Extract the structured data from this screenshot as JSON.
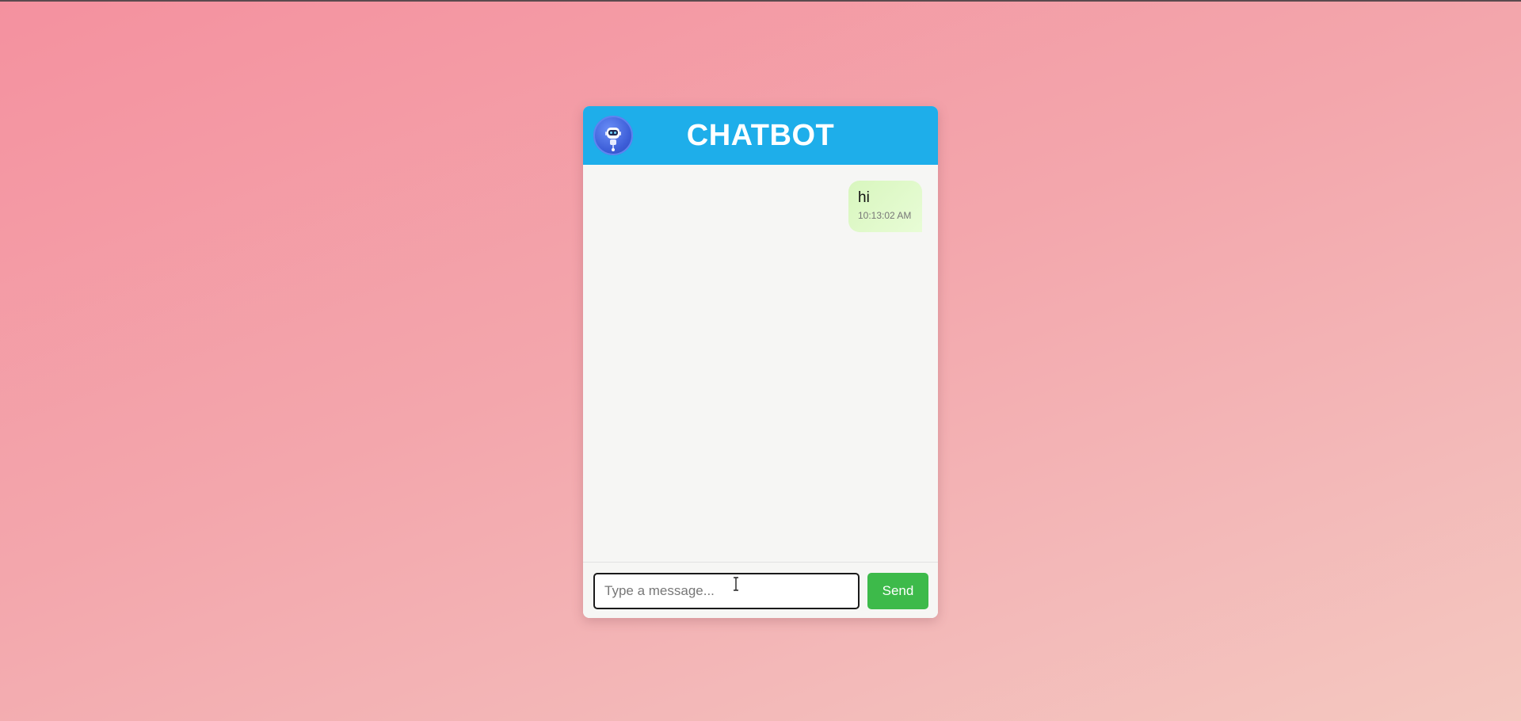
{
  "header": {
    "title": "CHATBOT",
    "avatar_icon": "robot-icon"
  },
  "messages": [
    {
      "sender": "user",
      "text": "hi",
      "time": "10:13:02 AM"
    }
  ],
  "composer": {
    "placeholder": "Type a message...",
    "value": "",
    "send_label": "Send"
  },
  "colors": {
    "header": "#1eaeea",
    "send_button": "#3dba4a",
    "user_bubble": "#dff9c8",
    "background_start": "#f4919f",
    "background_end": "#f4c8c0"
  }
}
